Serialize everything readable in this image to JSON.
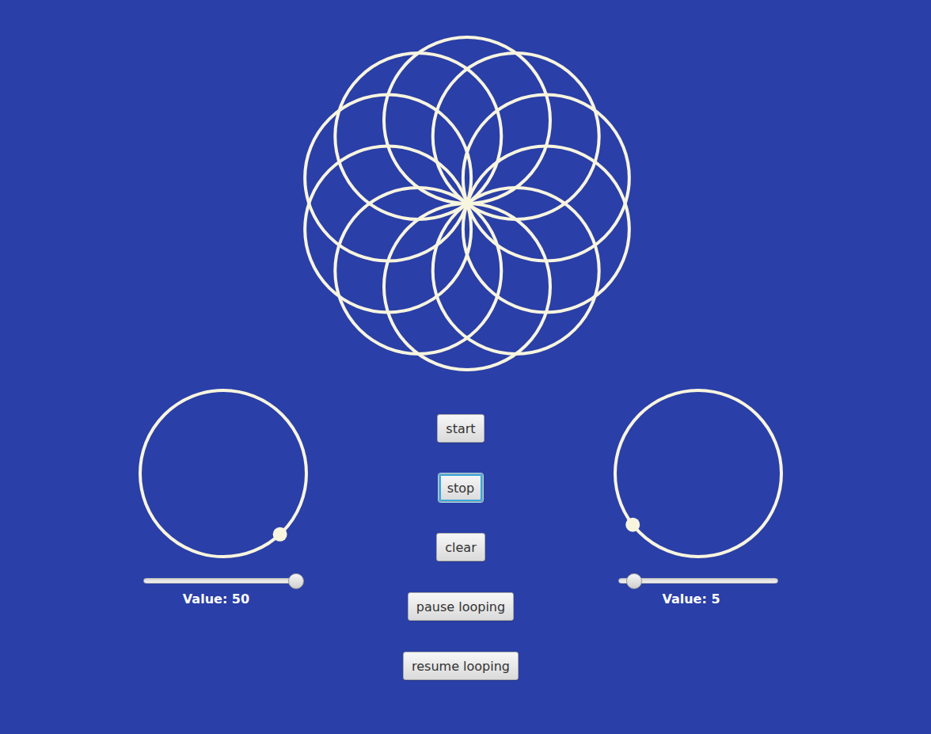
{
  "drawing": {
    "circles": 10
  },
  "dials": [
    {
      "name": "left",
      "dial_angle": 47,
      "slider": {
        "level": 1
      },
      "value_label": "Value: 50"
    },
    {
      "name": "right",
      "dial_angle": 142,
      "slider": {
        "level": 0.05
      },
      "value_label": "Value: 5"
    }
  ],
  "buttons": [
    {
      "label": "start",
      "focused": false
    },
    {
      "label": "stop",
      "focused": true
    },
    {
      "label": "clear",
      "focused": false
    },
    {
      "label": "pause looping",
      "focused": false
    },
    {
      "label": "resume looping",
      "focused": false
    }
  ]
}
